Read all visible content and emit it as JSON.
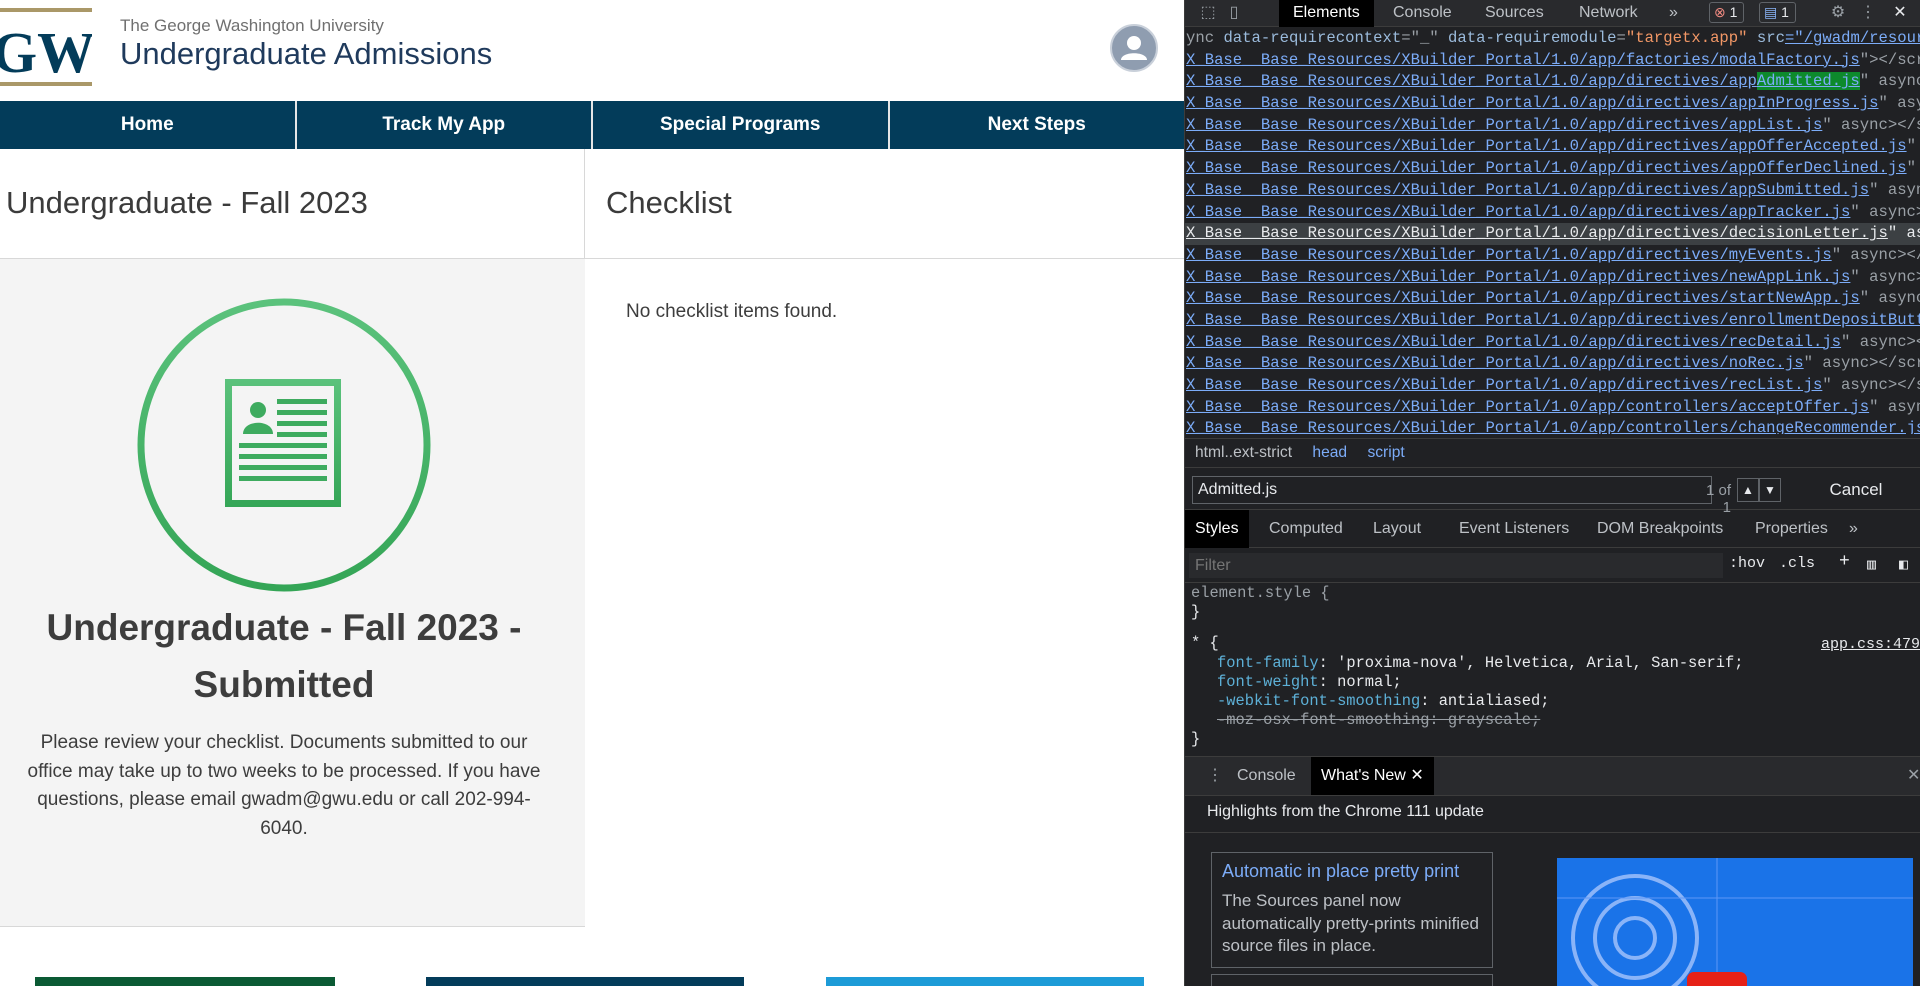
{
  "site": {
    "university": "The George Washington University",
    "title": "Undergraduate Admissions",
    "logo_text": "GW",
    "nav": [
      "Home",
      "Track My App",
      "Special Programs",
      "Next Steps"
    ],
    "application_heading": "Undergraduate - Fall 2023",
    "checklist_heading": "Checklist",
    "status_title": "Undergraduate - Fall 2023 - Submitted",
    "status_message": "Please review your checklist. Documents submitted to our office may take up to two weeks to be processed. If you have questions, please email gwadm@gwu.edu or call 202-994-6040.",
    "checklist_empty": "No checklist items found.",
    "colors": {
      "navy": "#033c5a",
      "gold": "#aa9868",
      "green": "#3fae63",
      "panel": "#f4f4f4"
    }
  },
  "devtools": {
    "tabs": [
      "Elements",
      "Console",
      "Sources",
      "Network"
    ],
    "more": "»",
    "error_count": "1",
    "message_count": "1",
    "dom_lines": [
      {
        "pre": "ync ",
        "attr": "data-requirecontext",
        "eq": "=\"_\" ",
        "attr2": "data-requiremodule",
        "eq2": "=",
        "val": "\"targetx.app\"",
        "attr3": " src",
        "link": "=\"/gwadm/resource/",
        "post": ""
      },
      {
        "link": "X_Base__Base_Resources/XBuilder_Portal/1.0/app/factories/modalFactory.js",
        "post": "\"></script"
      },
      {
        "link_pre": "X_Base__Base_Resources/XBuilder_Portal/1.0/app/directives/app",
        "hl": "Admitted.js",
        "post": "\" async></"
      },
      {
        "link": "X_Base__Base_Resources/XBuilder_Portal/1.0/app/directives/appInProgress.js",
        "post": "\" async><"
      },
      {
        "link": "X_Base__Base_Resources/XBuilder_Portal/1.0/app/directives/appList.js",
        "post": "\" async></scri"
      },
      {
        "link": "X_Base__Base_Resources/XBuilder_Portal/1.0/app/directives/appOfferAccepted.js",
        "post": "\" asy"
      },
      {
        "link": "X_Base__Base_Resources/XBuilder_Portal/1.0/app/directives/appOfferDeclined.js",
        "post": "\" asy"
      },
      {
        "link": "X_Base__Base_Resources/XBuilder_Portal/1.0/app/directives/appSubmitted.js",
        "post": "\" async><"
      },
      {
        "link": "X_Base__Base_Resources/XBuilder_Portal/1.0/app/directives/appTracker.js",
        "post": "\" async></s"
      },
      {
        "link": "X_Base__Base_Resources/XBuilder_Portal/1.0/app/directives/decisionLetter.js",
        "post": "\" async",
        "selected": true
      },
      {
        "link": "X_Base__Base_Resources/XBuilder_Portal/1.0/app/directives/myEvents.js",
        "post": "\" async></scr"
      },
      {
        "link": "X_Base__Base_Resources/XBuilder_Portal/1.0/app/directives/newAppLink.js",
        "post": "\" async></s"
      },
      {
        "link": "X_Base__Base_Resources/XBuilder_Portal/1.0/app/directives/startNewApp.js",
        "post": "\" async></"
      },
      {
        "link": "X_Base__Base_Resources/XBuilder_Portal/1.0/app/directives/enrollmentDepositButton.",
        "post": ""
      },
      {
        "link": "X_Base__Base_Resources/XBuilder_Portal/1.0/app/directives/recDetail.js",
        "post": "\" async></sc"
      },
      {
        "link": "X_Base__Base_Resources/XBuilder_Portal/1.0/app/directives/noRec.js",
        "post": "\" async></script"
      },
      {
        "link": "X_Base__Base_Resources/XBuilder_Portal/1.0/app/directives/recList.js",
        "post": "\" async></scri"
      },
      {
        "link": "X_Base__Base_Resources/XBuilder_Portal/1.0/app/controllers/acceptOffer.js",
        "post": "\" async></sc"
      },
      {
        "link": "X_Base__Base_Resources/XBuilder_Portal/1.0/app/controllers/changeRecommender.js",
        "post": "\" a"
      }
    ],
    "breadcrumbs": [
      "html..ext-strict",
      "head",
      "script"
    ],
    "search_value": "Admitted.js",
    "search_count": "1 of 1",
    "search_cancel": "Cancel",
    "styles_tabs": [
      "Styles",
      "Computed",
      "Layout",
      "Event Listeners",
      "DOM Breakpoints",
      "Properties"
    ],
    "filter_placeholder": "Filter",
    "hov": ":hov",
    "cls": ".cls",
    "rules": {
      "element_style": "element.style {",
      "close": "}",
      "universal": "* {",
      "source": "app.css:479",
      "props": [
        {
          "name": "font-family",
          "value": "'proxima-nova', Helvetica, Arial, San-serif;"
        },
        {
          "name": "font-weight",
          "value": "normal;"
        },
        {
          "name": "-webkit-font-smoothing",
          "value": "antialiased;"
        }
      ],
      "struck": "-moz-osx-font-smoothing: grayscale;"
    },
    "drawer_tabs": [
      "Console",
      "What's New"
    ],
    "whats_new_heading": "Highlights from the Chrome 111 update",
    "card_title": "Automatic in place pretty print",
    "card_body": "The Sources panel now automatically pretty-prints minified source files in place."
  }
}
